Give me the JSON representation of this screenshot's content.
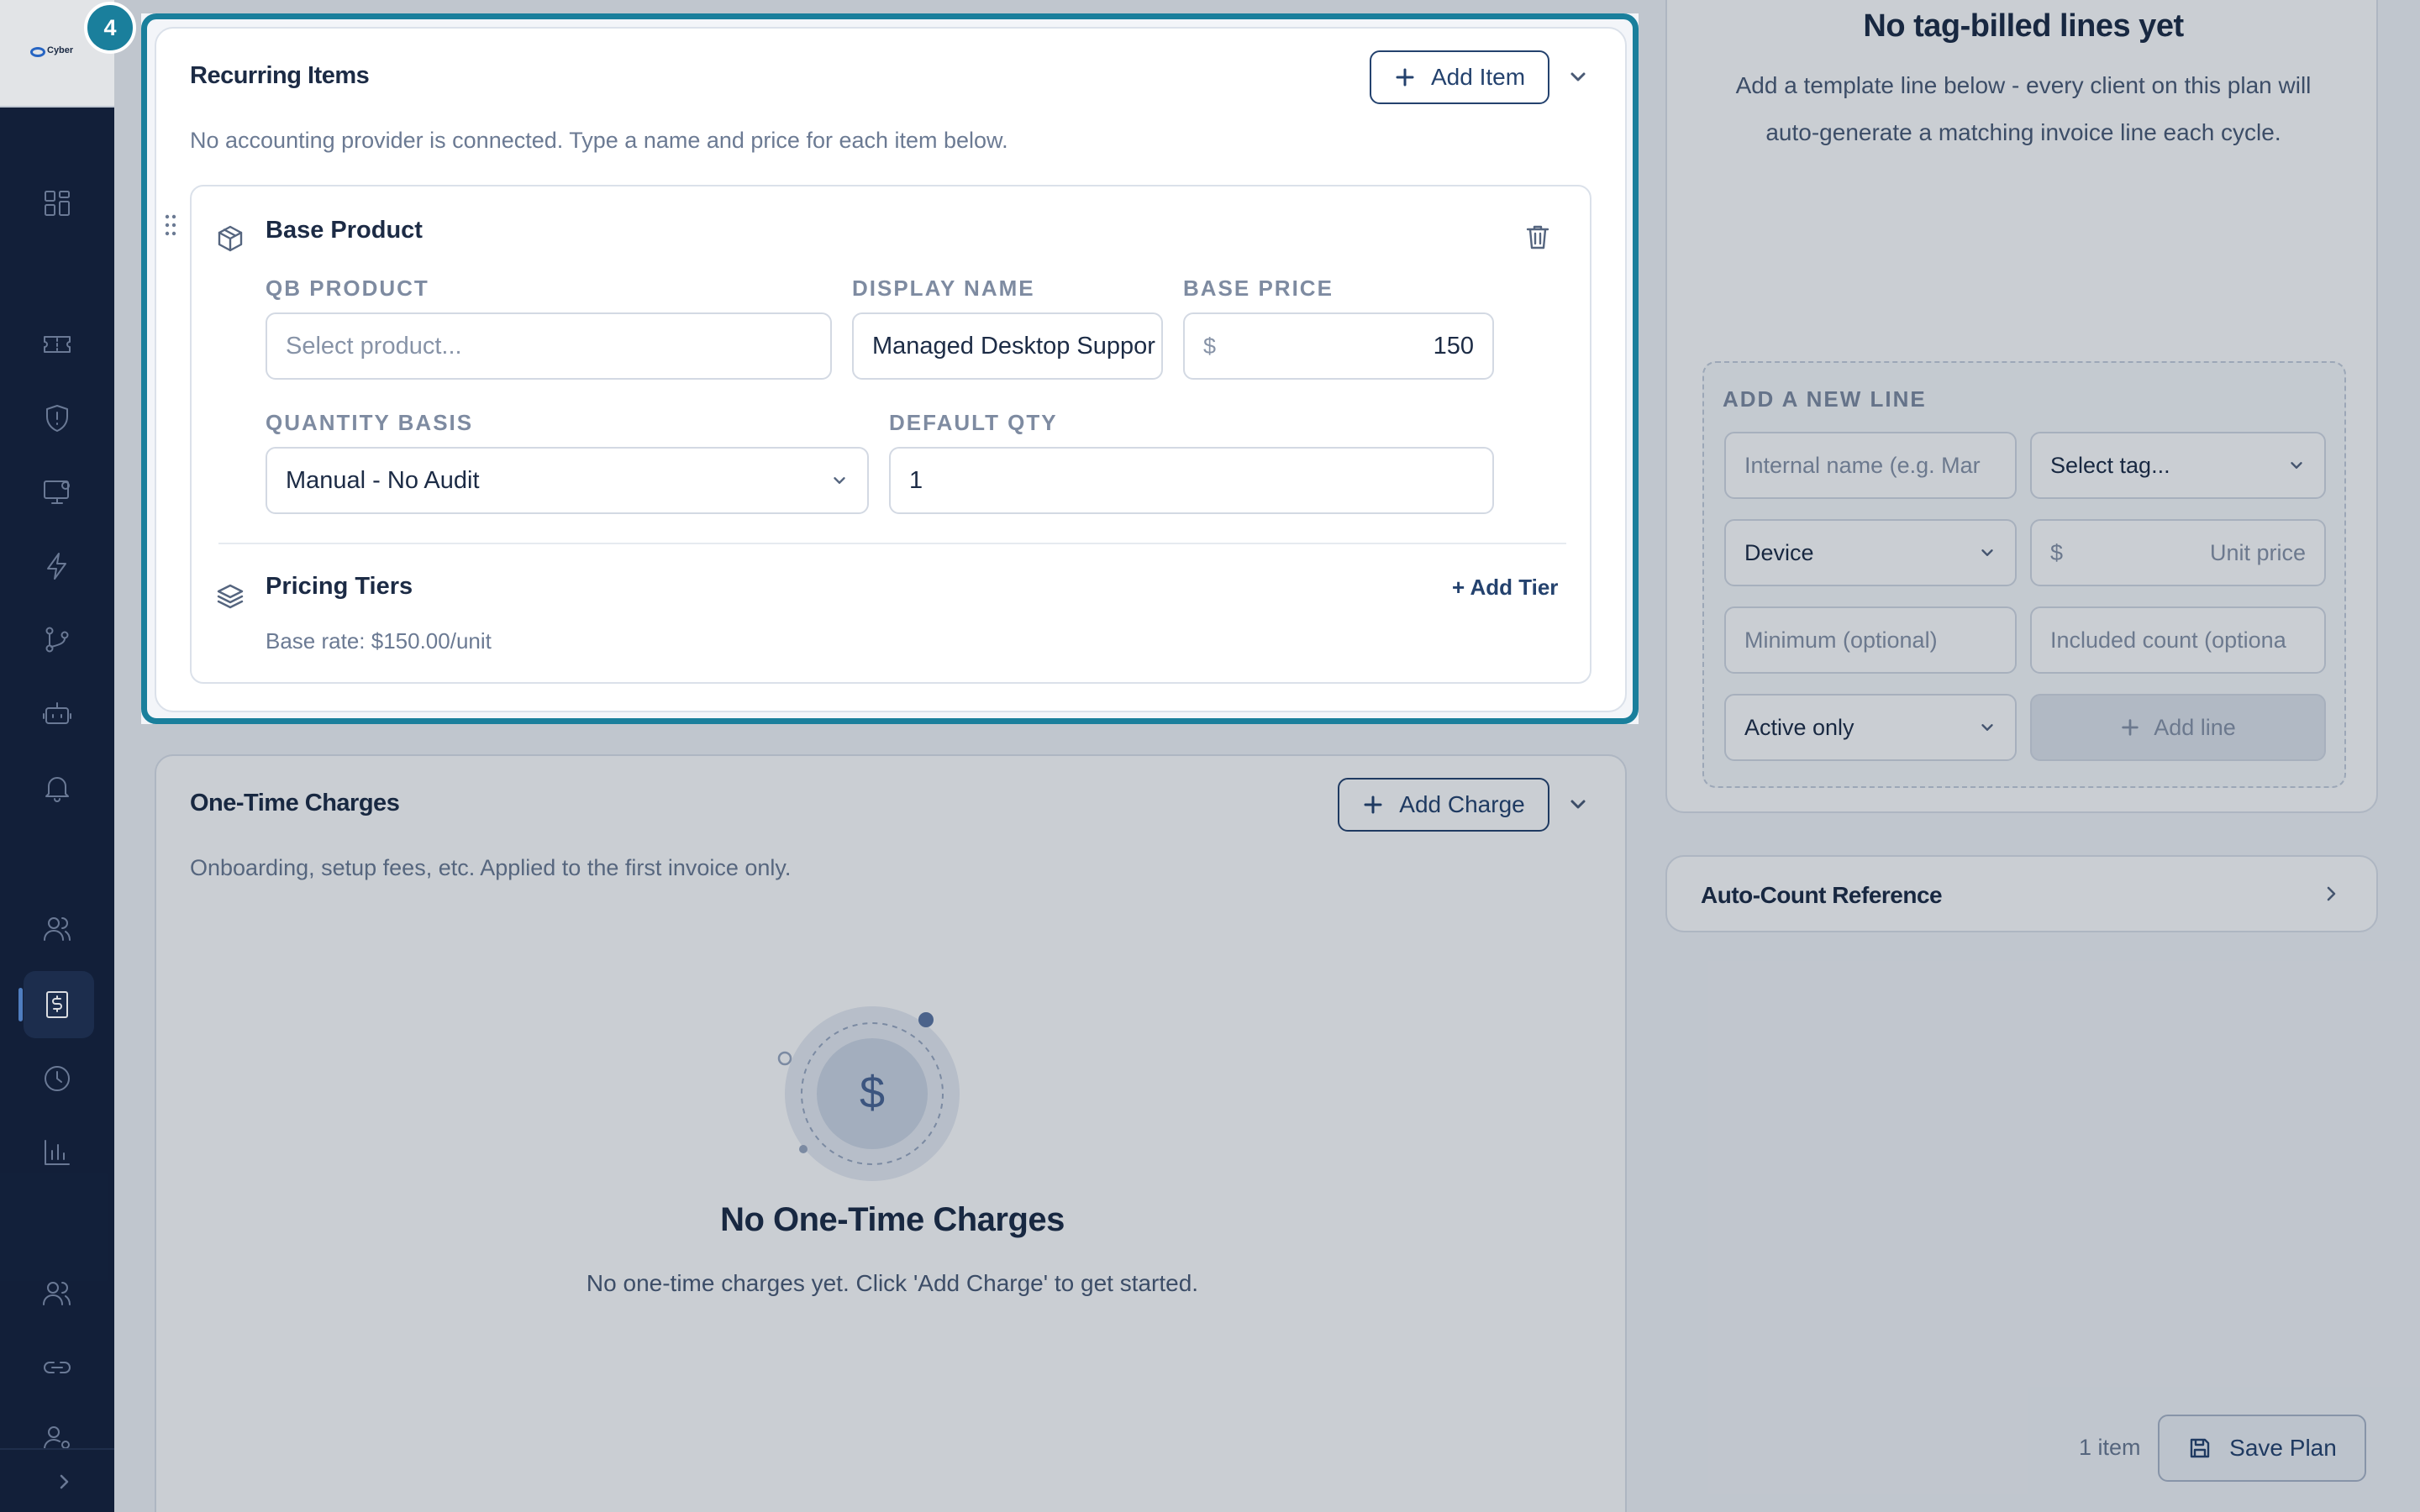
{
  "tour": {
    "step": "4"
  },
  "sidebar": {
    "logo_text": "Cyber",
    "items": [
      {
        "icon": "dashboard-grid-icon"
      },
      {
        "icon": "ticket-icon"
      },
      {
        "icon": "shield-alert-icon"
      },
      {
        "icon": "monitor-settings-icon"
      },
      {
        "icon": "lightning-icon"
      },
      {
        "icon": "git-branch-icon"
      },
      {
        "icon": "robot-icon"
      },
      {
        "icon": "bell-icon"
      },
      {
        "icon": "users-icon"
      },
      {
        "icon": "billing-icon",
        "active": true
      },
      {
        "icon": "clock-icon"
      },
      {
        "icon": "bar-chart-icon"
      },
      {
        "icon": "team-icon"
      },
      {
        "icon": "link-icon"
      },
      {
        "icon": "user-settings-icon"
      }
    ],
    "expand_icon": "chevron-right-icon"
  },
  "recurring": {
    "title": "Recurring Items",
    "add_label": "Add Item",
    "description": "No accounting provider is connected. Type a name and price for each item below.",
    "item": {
      "name": "Base Product",
      "qb_product_label": "QB PRODUCT",
      "qb_product_placeholder": "Select product...",
      "display_name_label": "DISPLAY NAME",
      "display_name_value": "Managed Desktop Suppor",
      "base_price_label": "BASE PRICE",
      "currency": "$",
      "base_price_value": "150",
      "quantity_basis_label": "QUANTITY BASIS",
      "quantity_basis_value": "Manual - No Audit",
      "default_qty_label": "DEFAULT QTY",
      "default_qty_value": "1",
      "pricing_tiers_label": "Pricing Tiers",
      "add_tier_label": "+ Add Tier",
      "base_rate": "Base rate: $150.00/unit"
    }
  },
  "one_time": {
    "title": "One-Time Charges",
    "add_label": "Add Charge",
    "description": "Onboarding, setup fees, etc. Applied to the first invoice only.",
    "empty_symbol": "$",
    "empty_title": "No One-Time Charges",
    "empty_text": "No one-time charges yet. Click 'Add Charge' to get started."
  },
  "tag_billed": {
    "empty_title": "No tag-billed lines yet",
    "empty_text_1": "Add a template line below - every client on this plan will",
    "empty_text_2": "auto-generate a matching invoice line each cycle.",
    "add_new_label": "ADD A NEW LINE",
    "internal_name_placeholder": "Internal name (e.g. Mar",
    "tag_select": "Select tag...",
    "type_select": "Device",
    "currency": "$",
    "unit_price_placeholder": "Unit price",
    "minimum_placeholder": "Minimum (optional)",
    "included_placeholder": "Included count (optiona",
    "status_select": "Active only",
    "add_line_label": "Add line"
  },
  "auto_count": {
    "title": "Auto-Count Reference"
  },
  "footer": {
    "item_count": "1 item",
    "save_label": "Save Plan"
  }
}
